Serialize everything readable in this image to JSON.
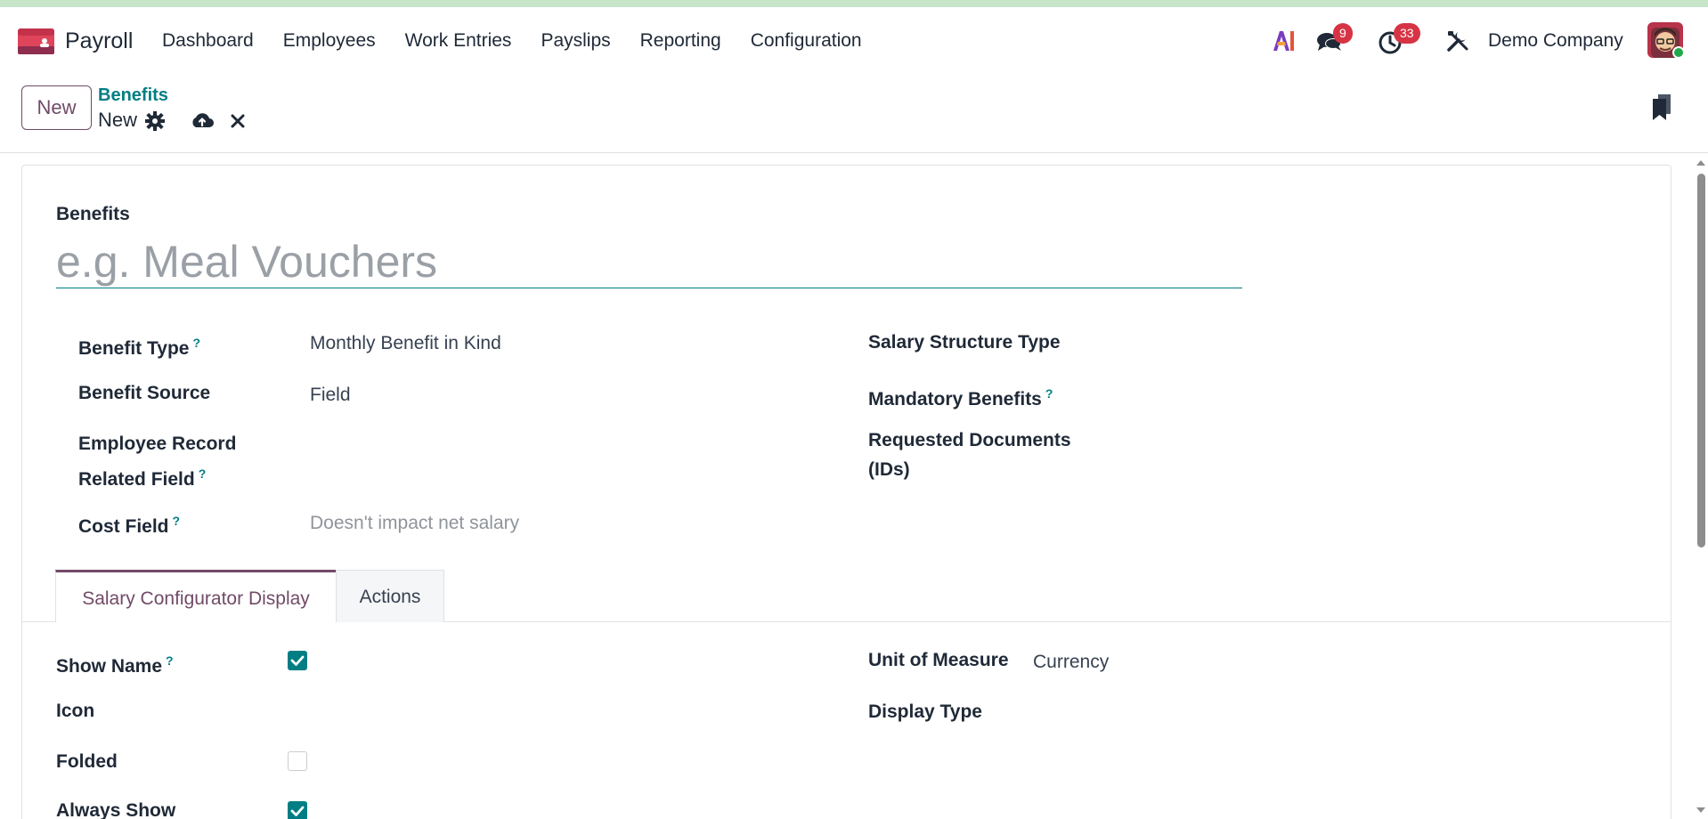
{
  "app": {
    "name": "Payroll"
  },
  "menu": [
    {
      "label": "Dashboard"
    },
    {
      "label": "Employees"
    },
    {
      "label": "Work Entries"
    },
    {
      "label": "Payslips"
    },
    {
      "label": "Reporting"
    },
    {
      "label": "Configuration"
    }
  ],
  "systray": {
    "messages_count": "9",
    "activities_count": "33",
    "company": "Demo Company"
  },
  "control": {
    "new_label": "New",
    "breadcrumb_parent": "Benefits",
    "breadcrumb_current": "New"
  },
  "form": {
    "name_label": "Benefits",
    "name_placeholder": "e.g. Meal Vouchers",
    "left_fields": {
      "benefit_type_label": "Benefit Type",
      "benefit_type_value": "Monthly Benefit in Kind",
      "benefit_source_label": "Benefit Source",
      "benefit_source_value": "Field",
      "employee_record_label_line1": "Employee Record",
      "employee_record_label_line2": "Related Field",
      "cost_field_label": "Cost Field",
      "cost_field_placeholder": "Doesn't impact net salary"
    },
    "right_fields": {
      "salary_structure_type_label": "Salary Structure Type",
      "mandatory_benefits_label": "Mandatory Benefits",
      "requested_documents_label_line1": "Requested Documents",
      "requested_documents_label_line2": "(IDs)"
    },
    "help_mark": "?"
  },
  "tabs": [
    {
      "label": "Salary Configurator Display",
      "active": true
    },
    {
      "label": "Actions",
      "active": false
    }
  ],
  "display_tab": {
    "show_name_label": "Show Name",
    "show_name_checked": true,
    "icon_label": "Icon",
    "folded_label": "Folded",
    "folded_checked": false,
    "always_show_label": "Always Show",
    "always_show_checked": true,
    "unit_of_measure_label": "Unit of Measure",
    "unit_of_measure_value": "Currency",
    "display_type_label": "Display Type"
  },
  "colors": {
    "brand": "#714b67",
    "accent": "#017e84",
    "badge": "#d63445",
    "top_strip": "#c7e5c9"
  }
}
